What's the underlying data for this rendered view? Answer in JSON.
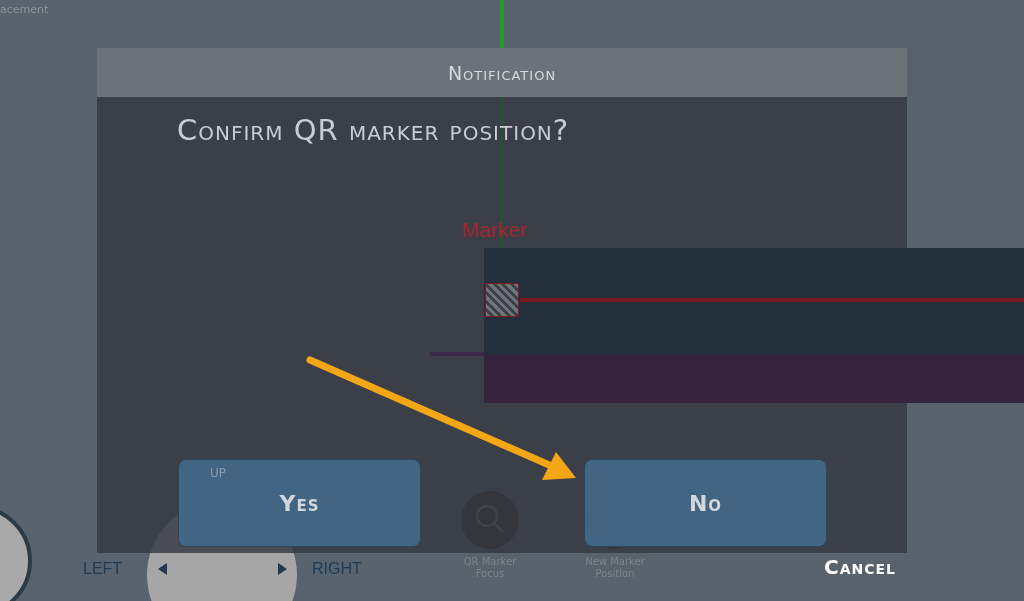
{
  "background_labels": {
    "top_left": "acement"
  },
  "scene": {
    "marker_label": "Marker"
  },
  "joypad": {
    "up": "UP",
    "left": "LEFT",
    "right": "RIGHT"
  },
  "tools": [
    {
      "label": "QR Marker",
      "label_2": "Focus",
      "kind": "search"
    },
    {
      "label": "New Marker",
      "label_2": "Position",
      "kind": "target"
    }
  ],
  "dialog": {
    "title": "Notification",
    "message": "Confirm QR marker position?",
    "buttons": [
      {
        "label": "Yes"
      },
      {
        "label": "No"
      }
    ]
  },
  "cancel": "Cancel"
}
